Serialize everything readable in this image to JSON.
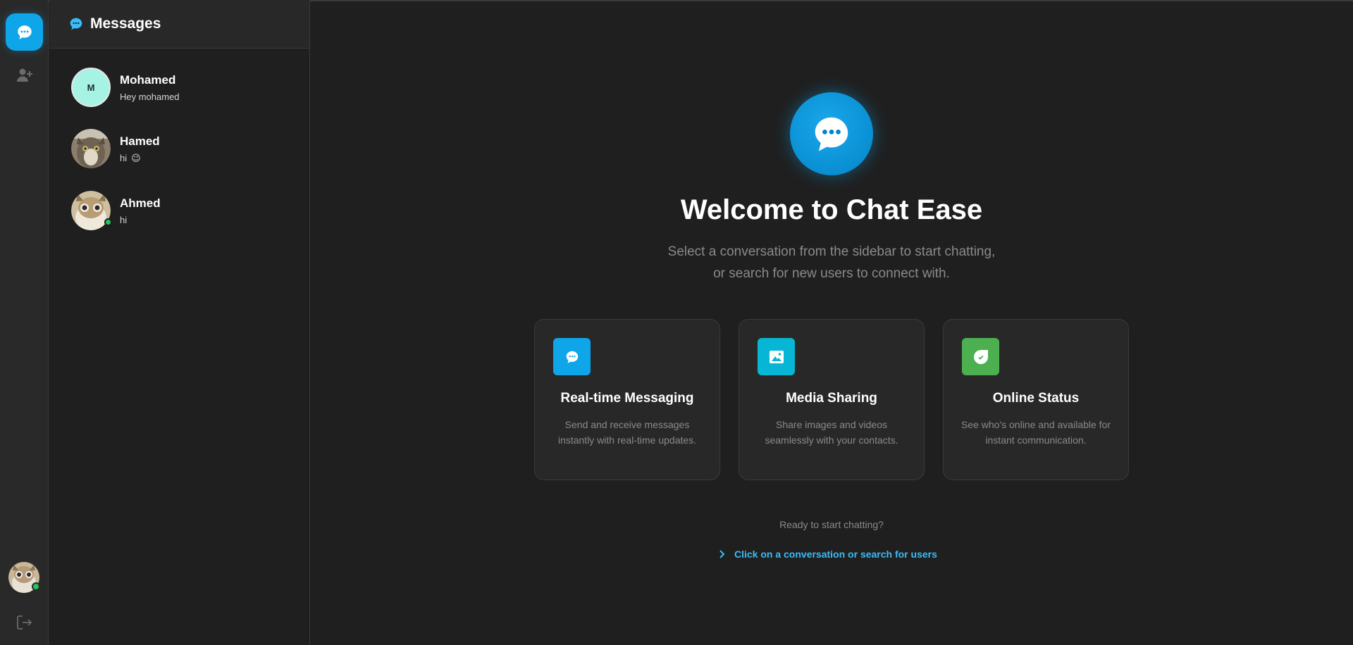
{
  "sidebar": {
    "title": "Messages",
    "conversations": [
      {
        "name": "Mohamed",
        "preview": "Hey mohamed",
        "avatar_initial": "M",
        "online": false
      },
      {
        "name": "Hamed",
        "preview": "hi",
        "emoji": "😉",
        "online": false
      },
      {
        "name": "Ahmed",
        "preview": "hi",
        "online": true
      }
    ]
  },
  "rail": {
    "icons": [
      "chat-bubble-icon",
      "add-user-icon",
      "logout-icon"
    ],
    "accent": "#0ea5e9"
  },
  "main": {
    "title": "Welcome to Chat Ease",
    "subtitle_line1": "Select a conversation from the sidebar to start chatting,",
    "subtitle_line2": "or search for new users to connect with.",
    "features": [
      {
        "title": "Real-time Messaging",
        "desc": "Send and receive messages instantly with real-time updates.",
        "icon": "chat-bubble-icon",
        "color": "#0ea5e9"
      },
      {
        "title": "Media Sharing",
        "desc": "Share images and videos seamlessly with your contacts.",
        "icon": "image-icon",
        "color": "#06b6d4"
      },
      {
        "title": "Online Status",
        "desc": "See who's online and available for instant communication.",
        "icon": "status-check-icon",
        "color": "#4caf50"
      }
    ],
    "ready_text": "Ready to start chatting?",
    "cta_text": "Click on a conversation or search for users"
  }
}
